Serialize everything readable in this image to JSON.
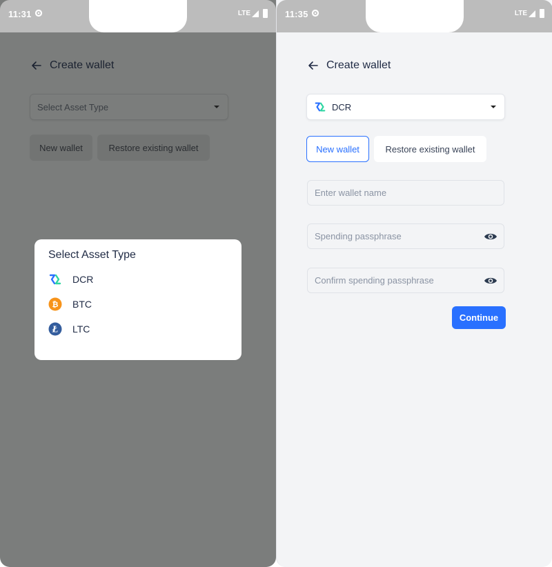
{
  "left_screen": {
    "status": {
      "time": "11:31",
      "network": "LTE"
    },
    "header": {
      "title": "Create wallet"
    },
    "asset_select": {
      "placeholder": "Select Asset Type"
    },
    "buttons": {
      "new_wallet": "New wallet",
      "restore_wallet": "Restore existing wallet"
    },
    "modal": {
      "title": "Select Asset Type",
      "options": [
        {
          "label": "DCR",
          "icon": "dcr-icon"
        },
        {
          "label": "BTC",
          "icon": "btc-icon"
        },
        {
          "label": "LTC",
          "icon": "ltc-icon"
        }
      ]
    }
  },
  "right_screen": {
    "status": {
      "time": "11:35",
      "network": "LTE"
    },
    "header": {
      "title": "Create wallet"
    },
    "asset_select": {
      "value": "DCR",
      "icon": "dcr-icon"
    },
    "tabs": {
      "new_wallet": "New wallet",
      "restore_wallet": "Restore existing wallet",
      "active": "new_wallet"
    },
    "form": {
      "wallet_name_placeholder": "Enter wallet name",
      "passphrase_placeholder": "Spending passphrase",
      "confirm_passphrase_placeholder": "Confirm spending passphrase"
    },
    "continue_label": "Continue"
  },
  "colors": {
    "accent": "#2970ff",
    "scrim": "#7b7d7c",
    "dcr_blue": "#2970ff",
    "dcr_green": "#2ed6a1",
    "btc_orange": "#f7931a",
    "ltc_blue": "#345d9d"
  }
}
